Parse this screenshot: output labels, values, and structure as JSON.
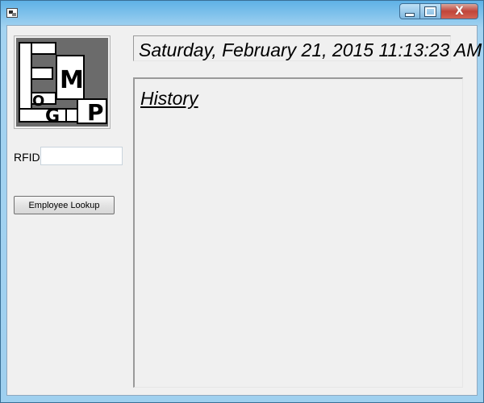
{
  "window": {
    "title": "",
    "controls": {
      "minimize": "minimize",
      "maximize": "maximize",
      "close": "X"
    }
  },
  "logo": {
    "letters": [
      "E",
      "M",
      "P",
      "L",
      "O",
      "G"
    ],
    "colors": {
      "background": "#6b6b6b",
      "blocks": "#ffffff",
      "ink": "#000000"
    }
  },
  "rfid": {
    "label": "RFID",
    "value": ""
  },
  "lookup_button": {
    "label": "Employee Lookup"
  },
  "datetime": {
    "text": "Saturday, February 21, 2015 11:13:23 AM"
  },
  "history": {
    "title": "History"
  },
  "colors": {
    "client_bg": "#f0f0f0",
    "titlebar": "#8cc4ea",
    "close_button": "#c94a3e"
  }
}
